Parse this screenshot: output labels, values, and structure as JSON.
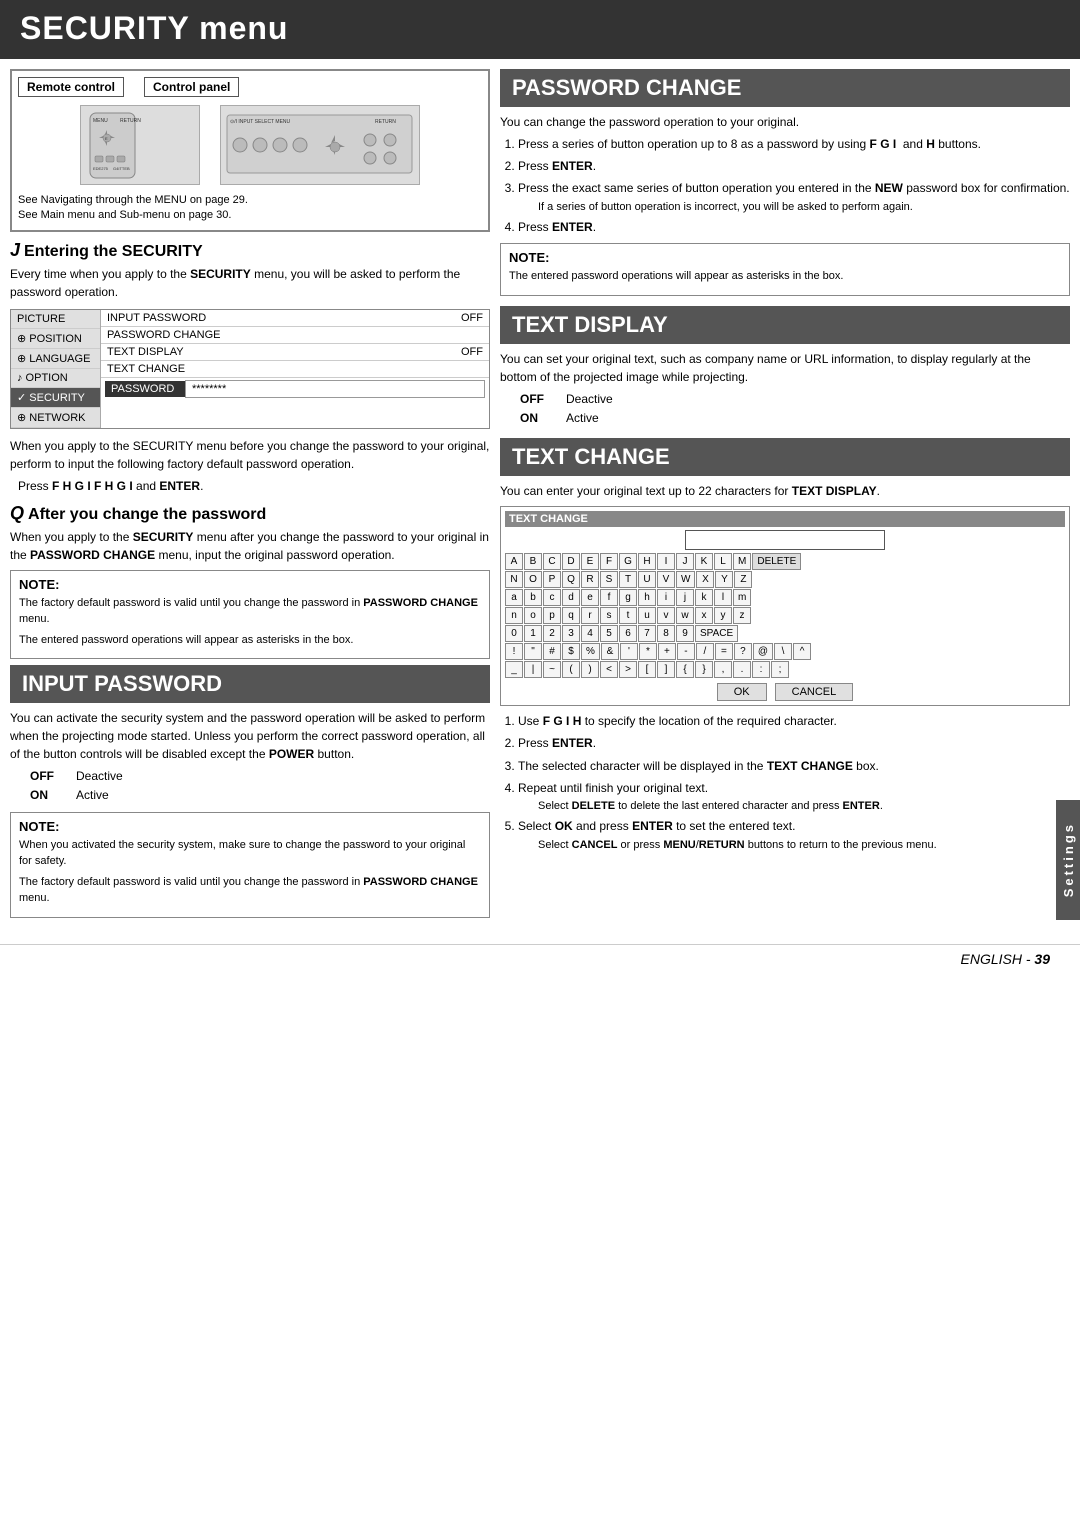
{
  "header": {
    "title": "SECURITY menu"
  },
  "remote_section": {
    "label_remote": "Remote control",
    "label_panel": "Control panel",
    "note_line1": "See  Navigating through the MENU  on page 29.",
    "note_line2": "See  Main menu and Sub-menu  on page 30."
  },
  "entering_security": {
    "letter": "J",
    "title": "Entering the SECURITY",
    "body": "Every time when you apply to the SECURITY menu, you will be asked to perform the password operation."
  },
  "menu_items": {
    "sidebar": [
      "PICTURE",
      "⊕ POSITION",
      "⊕ LANGUAGE",
      "♪ OPTION",
      "✓ SECURITY",
      "⊕ NETWORK"
    ],
    "content_rows": [
      {
        "label": "INPUT PASSWORD",
        "value": "OFF"
      },
      {
        "label": "PASSWORD CHANGE",
        "value": ""
      },
      {
        "label": "TEXT DISPLAY",
        "value": "OFF"
      },
      {
        "label": "TEXT CHANGE",
        "value": ""
      }
    ],
    "password_label": "PASSWORD",
    "password_value": "********"
  },
  "factory_default": {
    "body1": "When you apply to the SECURITY menu before you change the password to your original, perform to input the following factory default password operation.",
    "press_line": "Press F H G I  F H G I  and ENTER."
  },
  "after_password": {
    "letter": "Q",
    "title": "After you change the password",
    "body": "When you apply to the SECURITY menu after you change the password to your original in the PASSWORD CHANGE menu, input the original password operation."
  },
  "note1": {
    "title": "NOTE:",
    "lines": [
      "The factory default password is valid until you change the password in PASSWORD CHANGE menu.",
      "The entered password operations will appear as asterisks in the box."
    ]
  },
  "input_password": {
    "section_title": "INPUT PASSWORD",
    "body": "You can activate the security system and the password operation will be asked to perform when the projecting mode started. Unless you perform the correct password operation, all of the button controls will be disabled except the POWER button.",
    "off_label": "OFF",
    "off_value": "Deactive",
    "on_label": "ON",
    "on_value": "Active"
  },
  "note2": {
    "title": "NOTE:",
    "lines": [
      "When you activated the security system, make sure to change the password to your original for safety.",
      "The factory default password is valid until you change the password in PASSWORD CHANGE menu."
    ]
  },
  "password_change": {
    "section_title": "PASSWORD CHANGE",
    "body": "You can change the password operation to your original.",
    "steps": [
      "Press a series of button operation up to 8 as a password by using F G I  and H buttons.",
      "Press ENTER.",
      "Press the exact same series of button operation you entered in the NEW password box for confirmation.",
      "Press ENTER."
    ],
    "confirm_note": "If a series of button operation is incorrect, you will be asked to perform again.",
    "note_title": "NOTE:",
    "note_body": "The entered password operations will appear as asterisks in the box."
  },
  "text_display": {
    "section_title": "TEXT DISPLAY",
    "body": "You can set your original text, such as company name or URL information, to display regularly at the bottom of the projected image while projecting.",
    "off_label": "OFF",
    "off_value": "Deactive",
    "on_label": "ON",
    "on_value": "Active"
  },
  "text_change": {
    "section_title": "TEXT CHANGE",
    "body": "You can enter your original text up to 22 characters for TEXT DISPLAY.",
    "keyboard_title": "TEXT CHANGE",
    "row1": [
      "A",
      "B",
      "C",
      "D",
      "E",
      "F",
      "G",
      "H",
      "I",
      "J",
      "K",
      "L",
      "M"
    ],
    "row1_extra": "DELETE",
    "row2": [
      "N",
      "O",
      "P",
      "Q",
      "R",
      "S",
      "T",
      "U",
      "V",
      "W",
      "X",
      "Y",
      "Z"
    ],
    "row3": [
      "a",
      "b",
      "c",
      "d",
      "e",
      "f",
      "g",
      "h",
      "i",
      "j",
      "k",
      "l",
      "m"
    ],
    "row4": [
      "n",
      "o",
      "p",
      "q",
      "r",
      "s",
      "t",
      "u",
      "v",
      "w",
      "x",
      "y",
      "z"
    ],
    "row5": [
      "0",
      "1",
      "2",
      "3",
      "4",
      "5",
      "6",
      "7",
      "8",
      "9"
    ],
    "row5_extra": "SPACE",
    "row6": [
      "!",
      "\"",
      "#",
      "$",
      "%",
      "&",
      "'",
      "*",
      "+",
      "-",
      "/",
      "=",
      "?",
      "@",
      "\\",
      "^"
    ],
    "row7": [
      "_",
      "|",
      "~",
      "(",
      ")",
      "<",
      ">",
      "[",
      "]",
      "{",
      "}",
      ",",
      ".",
      ":",
      ";"
    ],
    "btn_ok": "OK",
    "btn_cancel": "CANCEL",
    "steps": [
      "Use F G I H to specify the location of the required character.",
      "Press ENTER.",
      "The selected character will be displayed in the TEXT CHANGE box.",
      "Repeat until finish your original text.",
      "Select DELETE to delete the last entered character and press ENTER.",
      "Select OK and press ENTER to set the entered text.",
      "Select CANCEL or press MENU/RETURN buttons to return to the previous menu."
    ]
  },
  "settings_tab": "Settings",
  "footer": {
    "prefix": "E",
    "text": "NGLISH - ",
    "page": "39"
  }
}
